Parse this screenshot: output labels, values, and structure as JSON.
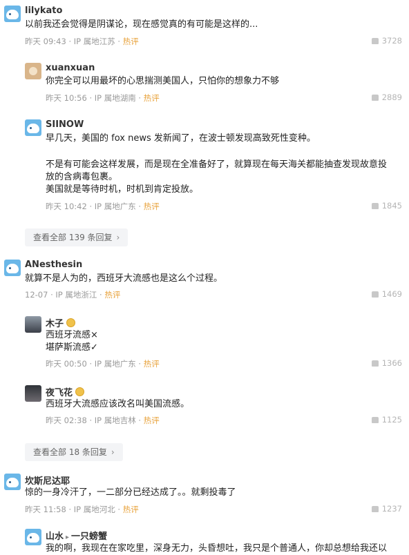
{
  "comments": [
    {
      "user": "lilykato",
      "text": [
        "以前我还会觉得是阴谋论，现在感觉真的有可能是这样的..."
      ],
      "time": "昨天 09:43",
      "ip": "IP 属地江苏",
      "hot": "热评",
      "likes": "3728"
    },
    {
      "user": "xuanxuan",
      "text": [
        "你完全可以用最坏的心思揣测美国人，只怕你的想象力不够"
      ],
      "time": "昨天 10:56",
      "ip": "IP 属地湖南",
      "hot": "热评",
      "likes": "2889"
    },
    {
      "user": "SIINOW",
      "text": [
        "早几天，美国的 fox news 发新闻了，在波士顿发现高致死性变种。",
        "",
        "不是有可能会这样发展，而是现在全准备好了，就算现在每天海关都能抽查发现故意投",
        "放的含病毒包裹。",
        "美国就是等待时机，时机到肯定投放。"
      ],
      "time": "昨天 10:42",
      "ip": "IP 属地广东",
      "hot": "热评",
      "likes": "1845"
    },
    {
      "user": "ANesthesin",
      "text": [
        "就算不是人为的，西班牙大流感也是这么个过程。"
      ],
      "time": "12-07",
      "ip": "IP 属地浙江",
      "hot": "热评",
      "likes": "1469"
    },
    {
      "user": "木子",
      "text": [
        "西班牙流感×",
        "堪萨斯流感✓"
      ],
      "time": "昨天 00:50",
      "ip": "IP 属地广东",
      "hot": "热评",
      "likes": "1366"
    },
    {
      "user": "夜飞花",
      "text": [
        "西班牙大流感应该改名叫美国流感。"
      ],
      "time": "昨天 02:38",
      "ip": "IP 属地吉林",
      "hot": "热评",
      "likes": "1125"
    },
    {
      "user": "坎斯尼达耶",
      "text": [
        "惊的一身冷汗了，一二部分已经达成了。。就剩投毒了"
      ],
      "time": "昨天 11:58",
      "ip": "IP 属地河北",
      "hot": "热评",
      "likes": "1237"
    },
    {
      "user": "山水",
      "reply_to": "一只螃蟹",
      "text": [
        "我的啊，我现在在家吃里，深身无力，头昏想吐，我只是个普通人，你却总想给我还以"
      ]
    }
  ],
  "more_replies": [
    "查看全部 139 条回复",
    "查看全部 18 条回复"
  ],
  "icons": {
    "like": "thumb-up-icon",
    "chevron": "chevron-right-icon",
    "badge": "level-badge-icon"
  }
}
